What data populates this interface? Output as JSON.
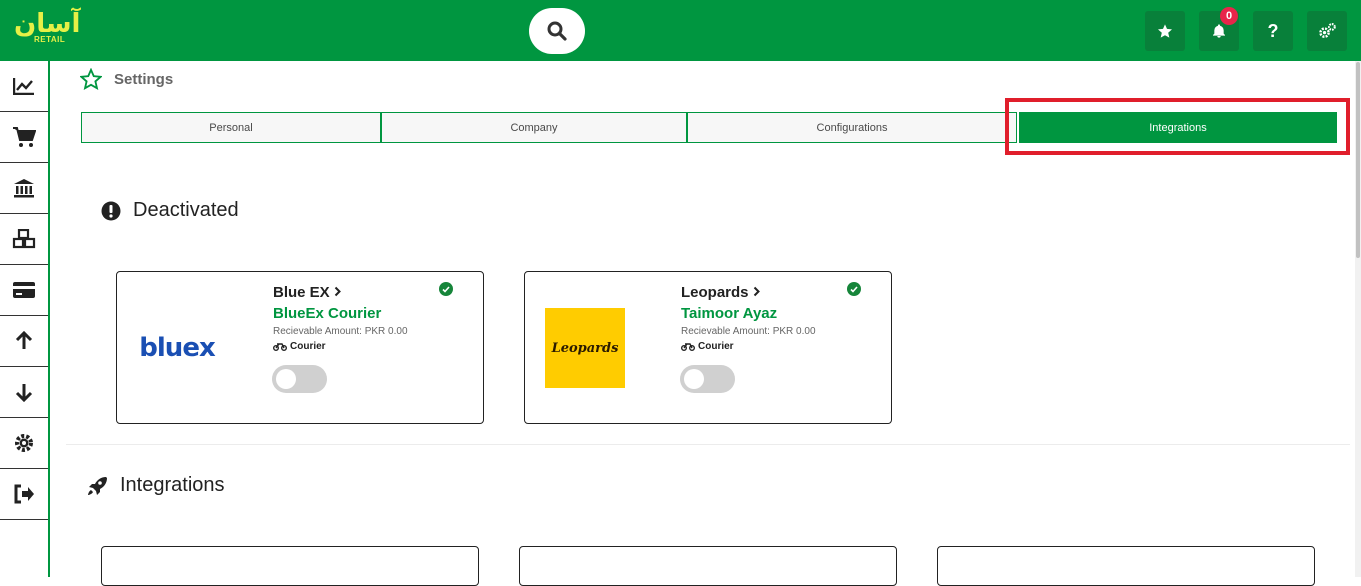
{
  "app": {
    "logo_main": "آسان",
    "logo_sub": "RETAIL"
  },
  "header": {
    "notifications_count": "0",
    "help_label": "?",
    "icons": [
      "star-icon",
      "bell-icon",
      "help-icon",
      "cogs-icon"
    ]
  },
  "sidebar": {
    "items": [
      "dashboard-chart-icon",
      "cart-icon",
      "bank-icon",
      "cubes-icon",
      "credit-card-icon",
      "arrow-up-icon",
      "arrow-down-icon",
      "gear-icon",
      "sign-out-icon"
    ]
  },
  "settings": {
    "title": "Settings"
  },
  "tabs": [
    {
      "label": "Personal"
    },
    {
      "label": "Company"
    },
    {
      "label": "Configurations"
    },
    {
      "label": "Integrations",
      "active": true
    }
  ],
  "deactivated": {
    "heading": "Deactivated",
    "cards": [
      {
        "title": "Blue EX",
        "subtitle": "BlueEx Courier",
        "amount": "Recievable Amount: PKR 0.00",
        "type": "Courier",
        "logo_text": "bluex",
        "enabled": false
      },
      {
        "title": "Leopards",
        "subtitle": "Taimoor Ayaz",
        "amount": "Recievable Amount: PKR 0.00",
        "type": "Courier",
        "logo_text": "Leopards",
        "enabled": false
      }
    ]
  },
  "integrations": {
    "heading": "Integrations"
  },
  "colors": {
    "brand_green": "#009640",
    "highlight_red": "#e01e2b",
    "badge_red": "#e8254a",
    "leopards_yellow": "#ffcc00",
    "bluex_blue": "#1a4fb3"
  }
}
